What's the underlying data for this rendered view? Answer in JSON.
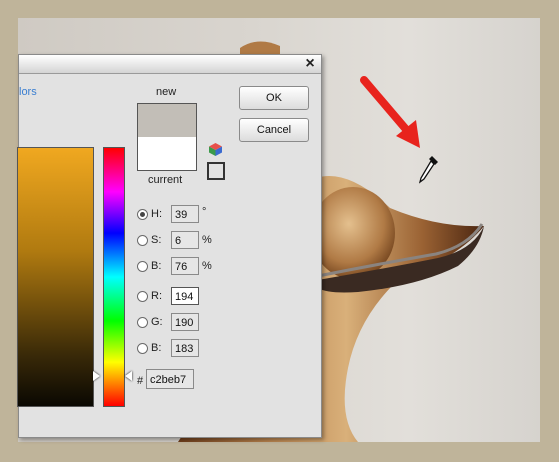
{
  "dialog": {
    "close_icon": "×",
    "link_text": "lors",
    "label_new": "new",
    "label_current": "current",
    "ok_label": "OK",
    "cancel_label": "Cancel",
    "new_color": "#c2beb7",
    "current_color": "#ffffff",
    "fields": {
      "h": {
        "label": "H:",
        "value": "39",
        "unit": "°"
      },
      "s": {
        "label": "S:",
        "value": "6",
        "unit": "%"
      },
      "b": {
        "label": "B:",
        "value": "76",
        "unit": "%"
      },
      "r": {
        "label": "R:",
        "value": "194"
      },
      "g": {
        "label": "G:",
        "value": "190"
      },
      "b2": {
        "label": "B:",
        "value": "183"
      }
    },
    "hash": "#",
    "hex_value": "c2beb7"
  },
  "colors": {
    "arrow": "#e8231d",
    "link": "#3b7fd1"
  },
  "icons": {
    "eyedropper": "eyedropper-icon",
    "arrow": "red-arrow-annotation",
    "cube": "color-cube-icon"
  }
}
